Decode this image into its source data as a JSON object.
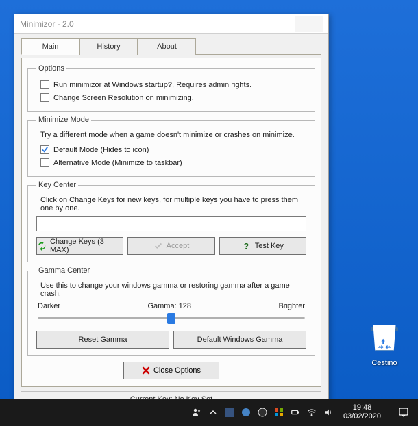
{
  "window": {
    "title": "Minimizor - 2.0"
  },
  "tabs": {
    "main": "Main",
    "history": "History",
    "about": "About"
  },
  "options": {
    "legend": "Options",
    "startup": "Run minimizor at Windows startup?, Requires admin rights.",
    "resolution": "Change Screen Resolution on minimizing."
  },
  "minimize": {
    "legend": "Minimize Mode",
    "note": "Try a different mode when a game doesn't minimize or crashes on minimize.",
    "default": "Default Mode (Hides to icon)",
    "alt": "Alternative Mode (Minimize to taskbar)"
  },
  "keycenter": {
    "legend": "Key Center",
    "note": "Click on Change Keys for new keys, for multiple keys you have to press them one by one.",
    "change": "Change Keys (3 MAX)",
    "accept": "Accept",
    "test": "Test Key"
  },
  "gamma": {
    "legend": "Gamma Center",
    "note": "Use this to change your windows gamma or restoring gamma after a game crash.",
    "darker": "Darker",
    "value": "Gamma: 128",
    "brighter": "Brighter",
    "reset": "Reset Gamma",
    "default": "Default Windows Gamma"
  },
  "close_options": "Close Options",
  "status": "Current Key: No Key Set",
  "desktop": {
    "cestino": "Cestino"
  },
  "clock": {
    "time": "19:48",
    "date": "03/02/2020"
  }
}
